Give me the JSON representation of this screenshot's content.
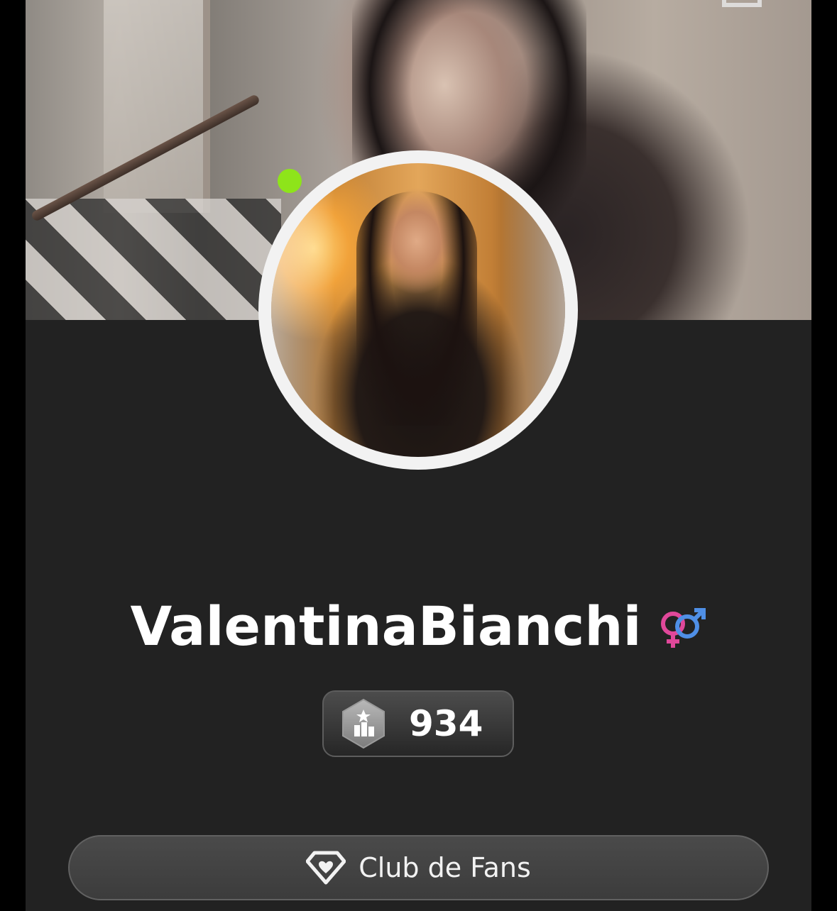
{
  "profile": {
    "username": "ValentinaBianchi",
    "online": true,
    "gender_icon": "female-male-symbol-icon",
    "level": "934",
    "level_icon": "hexagon-level-icon"
  },
  "actions": {
    "fans_club_label": "Club de Fans",
    "fans_club_icon": "diamond-heart-icon"
  },
  "colors": {
    "background": "#222222",
    "online_dot": "#8ee41a",
    "gender_female": "#e0489a",
    "gender_male": "#4f8fe6"
  }
}
